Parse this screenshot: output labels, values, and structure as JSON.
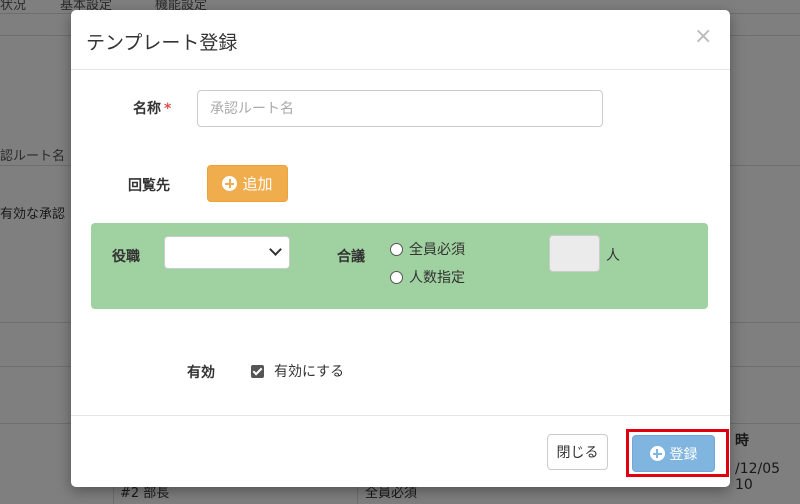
{
  "background": {
    "tabs": [
      "状況",
      "基本設定",
      "機能設定"
    ],
    "field_label": "認ルート名",
    "text": "有効な承認",
    "column_header": "時",
    "date_cell": "/12/05 10",
    "row_role": "#2 部長",
    "row_agreement": "全員必須"
  },
  "modal": {
    "title": "テンプレート登録",
    "close_icon": "×",
    "name_label": "名称",
    "required_mark": "*",
    "name_placeholder": "承認ルート名",
    "name_value": "",
    "circulation_label": "回覧先",
    "add_button_label": "追加",
    "role_label": "役職",
    "role_selected": "",
    "agreement_label": "合議",
    "agreement_options": [
      "全員必須",
      "人数指定"
    ],
    "count_value": "",
    "count_unit": "人",
    "enabled_label": "有効",
    "enabled_checkbox_label": "有効にする",
    "enabled_checked": true,
    "close_button_label": "閉じる",
    "register_button_label": "登録"
  },
  "colors": {
    "add_button": "#f0ad4e",
    "green_panel": "#a0d1a0",
    "register_button": "#80b5e0",
    "highlight_outline": "#e00010"
  },
  "icons": {
    "close": "close-icon",
    "add": "plus-circle-icon",
    "select": "chevron-down-icon",
    "register": "plus-circle-icon"
  }
}
